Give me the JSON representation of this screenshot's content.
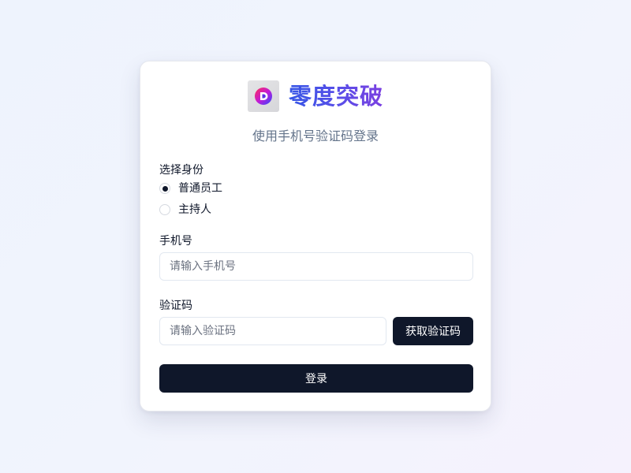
{
  "brand": {
    "name": "零度突破",
    "logo_icon": "brand-logo-icon"
  },
  "subtitle": "使用手机号验证码登录",
  "role": {
    "label": "选择身份",
    "options": [
      {
        "label": "普通员工",
        "checked": true
      },
      {
        "label": "主持人",
        "checked": false
      }
    ]
  },
  "phone": {
    "label": "手机号",
    "value": "",
    "placeholder": "请输入手机号"
  },
  "code": {
    "label": "验证码",
    "value": "",
    "placeholder": "请输入验证码",
    "send_button": "获取验证码"
  },
  "submit_label": "登录",
  "colors": {
    "primary": "#0f172a",
    "brand_start": "#3556e6",
    "brand_end": "#7b3fe0",
    "muted_text": "#64748b",
    "border": "#e2e8f0"
  }
}
